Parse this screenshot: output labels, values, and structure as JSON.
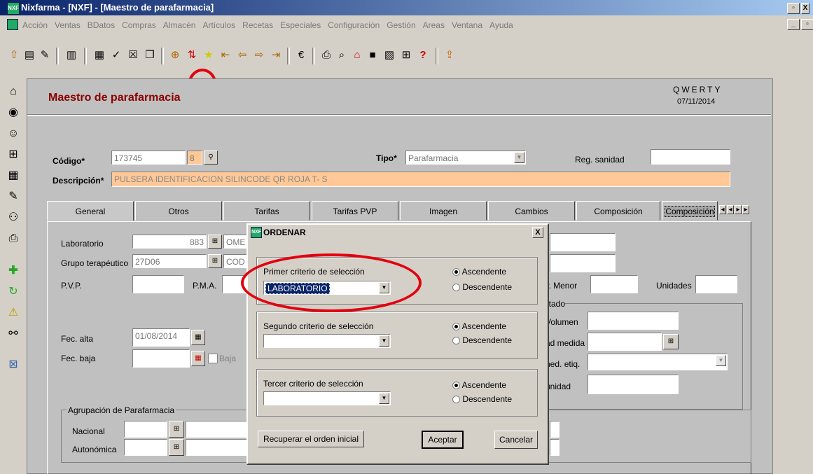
{
  "window": {
    "title": "Nixfarma - [NXF] - [Maestro de parafarmacia]",
    "app_icon": "NXF"
  },
  "menu": [
    "Acción",
    "Ventas",
    "BDatos",
    "Compras",
    "Almacén",
    "Artículos",
    "Recetas",
    "Especiales",
    "Configuración",
    "Gestión",
    "Areas",
    "Ventana",
    "Ayuda"
  ],
  "header": {
    "title": "Maestro de parafarmacia",
    "user": "QWERTY",
    "date": "07/11/2014"
  },
  "form": {
    "codigo_label": "Código*",
    "codigo_value": "173745",
    "codigo_check": "8",
    "tipo_label": "Tipo*",
    "tipo_value": "Parafarmacia",
    "reg_label": "Reg. sanidad",
    "desc_label": "Descripción*",
    "desc_value": "PULSERA IDENTIFICACION SILINCODE QR  ROJA T- S"
  },
  "tabs": [
    "General",
    "Otros",
    "Tarifas",
    "Tarifas PVP",
    "Imagen",
    "Cambios",
    "Composición",
    "Composición"
  ],
  "general": {
    "laboratorio_label": "Laboratorio",
    "laboratorio_value": "883",
    "laboratorio_name": "OME",
    "grupo_label": "Grupo terapéutico",
    "grupo_value": "27D06",
    "grupo_name": "COD",
    "pvp_label": "P.V.P.",
    "pma_label": "P.M.A.",
    "pmenor_label": "P. Menor",
    "unidades_label": "Unidades",
    "etado_label": "etado",
    "volumen_label": "Volumen",
    "admedida_label": "ad medida",
    "nedetiq_label": "ned. etiq.",
    "unidad_label": "unidad",
    "fecalta_label": "Fec. alta",
    "fecalta_value": "01/08/2014",
    "fecbaja_label": "Fec. baja",
    "baja_label": "Baja",
    "agrup_label": "Agrupación de Parafarmacia",
    "nacional_label": "Nacional",
    "autonomica_label": "Autonómica"
  },
  "dialog": {
    "title": "ORDENAR",
    "close": "X",
    "crit1_label": "Primer criterio de selección",
    "crit1_value": "LABORATORIO",
    "crit2_label": "Segundo criterio de selección",
    "crit2_value": "",
    "crit3_label": "Tercer criterio de selección",
    "crit3_value": "",
    "asc": "Ascendente",
    "desc": "Descendente",
    "btn_recuperar": "Recuperar el orden inicial",
    "btn_aceptar": "Aceptar",
    "btn_cancelar": "Cancelar"
  },
  "colors": {
    "highlight_fill": "#ffc896",
    "selected_combo": "#0a246a",
    "annotation_red": "#e3000f"
  }
}
